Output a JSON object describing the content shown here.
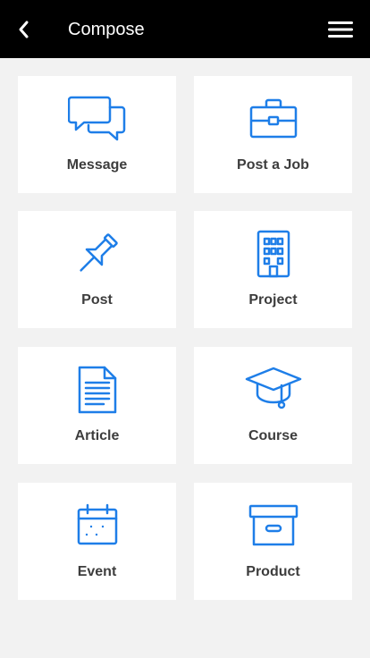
{
  "header": {
    "title": "Compose",
    "back_icon": "chevron-left-icon",
    "menu_icon": "hamburger-menu-icon",
    "background": "#000000"
  },
  "accent_color": "#1e7ee8",
  "tiles": [
    {
      "label": "Message",
      "icon": "chat-bubbles-icon"
    },
    {
      "label": "Post a Job",
      "icon": "briefcase-icon"
    },
    {
      "label": "Post",
      "icon": "pushpin-icon"
    },
    {
      "label": "Project",
      "icon": "building-icon"
    },
    {
      "label": "Article",
      "icon": "document-icon"
    },
    {
      "label": "Course",
      "icon": "graduation-cap-icon"
    },
    {
      "label": "Event",
      "icon": "calendar-icon"
    },
    {
      "label": "Product",
      "icon": "archive-box-icon"
    }
  ]
}
